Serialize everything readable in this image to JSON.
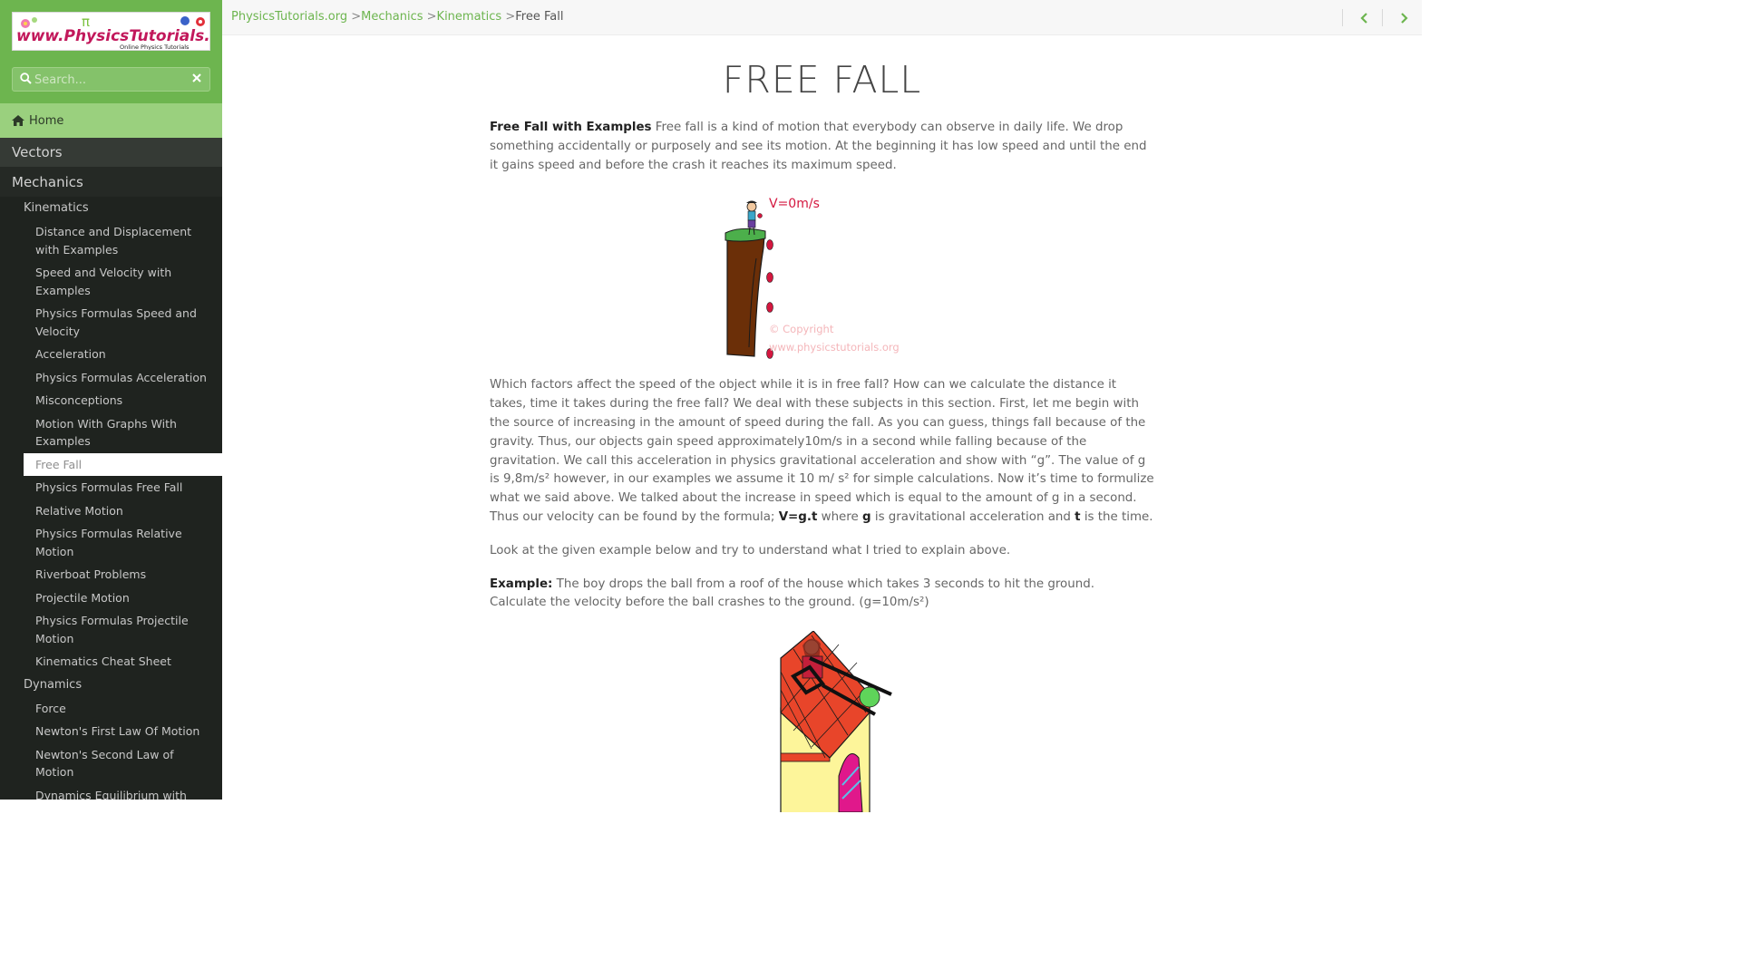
{
  "site": {
    "logo_text": "www.PhysicsTutorials.org",
    "logo_subtext": "Online Physics Tutorials"
  },
  "search": {
    "placeholder": "Search..."
  },
  "sidebar": {
    "home_label": "Home",
    "vectors_label": "Vectors",
    "mechanics_label": "Mechanics",
    "kinematics_label": "Kinematics",
    "kinematics_items": [
      {
        "label": "Distance and Displacement with Examples"
      },
      {
        "label": "Speed and Velocity with Examples"
      },
      {
        "label": "Physics Formulas Speed and Velocity"
      },
      {
        "label": "Acceleration"
      },
      {
        "label": "Physics Formulas Acceleration"
      },
      {
        "label": "Misconceptions"
      },
      {
        "label": "Motion With Graphs With Examples"
      },
      {
        "label": "Free Fall"
      },
      {
        "label": "Physics Formulas Free Fall"
      },
      {
        "label": "Relative Motion"
      },
      {
        "label": "Physics Formulas Relative Motion"
      },
      {
        "label": "Riverboat Problems"
      },
      {
        "label": "Projectile Motion"
      },
      {
        "label": "Physics Formulas Projectile Motion"
      },
      {
        "label": "Kinematics Cheat Sheet"
      }
    ],
    "dynamics_label": "Dynamics",
    "dynamics_items": [
      {
        "label": "Force"
      },
      {
        "label": "Newton's First Law Of Motion"
      },
      {
        "label": "Newton's Second Law of Motion"
      },
      {
        "label": "Dynamics Equilibrium with"
      }
    ]
  },
  "breadcrumb": {
    "root": "PhysicsTutorials.org",
    "sep": ">",
    "mechanics": "Mechanics",
    "kinematics": "Kinematics",
    "current": "Free Fall"
  },
  "page": {
    "title": "FREE FALL",
    "intro_bold": "Free Fall with Examples",
    "intro_text": " Free fall is a kind of motion that everybody can observe in daily life. We drop something accidentally or purposely and see its motion. At the beginning it has low speed and until the end it gains speed and before the crash it reaches its maximum speed.",
    "fig1_label": "V=0m/s",
    "fig1_copyright_1": "© Copyright",
    "fig1_copyright_2": "www.physicstutorials.org",
    "para2_text": "Which factors affect the speed of the object while it is in free fall? How can we calculate the distance it takes, time it takes during the free fall? We deal with these subjects in this section. First, let me begin with the source of increasing in the amount of speed during the fall. As you can guess, things fall because of the gravity. Thus, our objects gain speed approximately10m/s in a second while falling because of the gravitation. We call this acceleration in physics gravitational acceleration and show with “g”. The value of g is 9,8m/s² however, in our examples we assume it 10 m/ s² for simple calculations. Now it’s time to formulize what we said above. We talked about the increase in speed which is equal to the amount of g in a second. Thus our velocity can be found by the formula; ",
    "para2_formula": "V=g.t",
    "para2_where": " where ",
    "para2_g": "g",
    "para2_is_grav": " is gravitational acceleration and ",
    "para2_t": "t",
    "para2_end": " is the time.",
    "para3_text": "Look at the given example below and try to understand what I tried to explain above.",
    "example_label": "Example:",
    "example_text": " The boy drops the ball from a roof of the house which takes 3 seconds to hit the ground. Calculate the velocity before the ball crashes to the ground. (g=10m/s²)"
  },
  "colors": {
    "accent_green": "#6db54f",
    "sidebar_dark": "#2a2e2a",
    "ball_red": "#d4173f",
    "cliff_brown": "#6b2f08"
  }
}
